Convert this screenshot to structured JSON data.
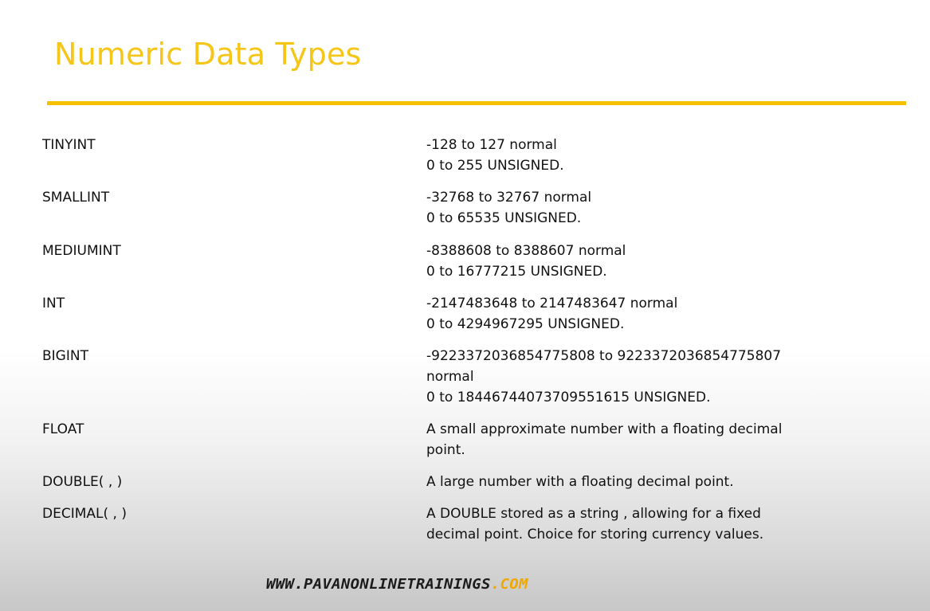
{
  "slide": {
    "title": "Numeric Data Types",
    "accent_color": "#f5c000"
  },
  "rows": [
    {
      "name": "TINYINT",
      "desc": [
        "-128 to 127 normal",
        "0 to 255 UNSIGNED."
      ]
    },
    {
      "name": "SMALLINT",
      "desc": [
        "-32768 to 32767 normal",
        "0 to 65535 UNSIGNED."
      ]
    },
    {
      "name": "MEDIUMINT",
      "desc": [
        "-8388608 to 8388607 normal",
        "0 to 16777215 UNSIGNED."
      ]
    },
    {
      "name": "INT",
      "desc": [
        "-2147483648 to 2147483647 normal",
        "0 to 4294967295 UNSIGNED."
      ]
    },
    {
      "name": "BIGINT",
      "desc": [
        "-9223372036854775808 to 9223372036854775807",
        "normal",
        "0 to 18446744073709551615 UNSIGNED."
      ]
    },
    {
      "name": "FLOAT",
      "desc": [
        "A small approximate number with a floating decimal",
        "point."
      ]
    },
    {
      "name": "DOUBLE( , )",
      "desc": [
        "A large number with a floating decimal point."
      ]
    },
    {
      "name": "DECIMAL( , )",
      "desc": [
        "A DOUBLE stored as a string , allowing for a fixed",
        "decimal point. Choice for storing currency values."
      ]
    }
  ],
  "footer": {
    "site": "WWW.PAVANONLINETRAININGS",
    "tld": ".COM",
    "tld_color": "#f0a800"
  }
}
